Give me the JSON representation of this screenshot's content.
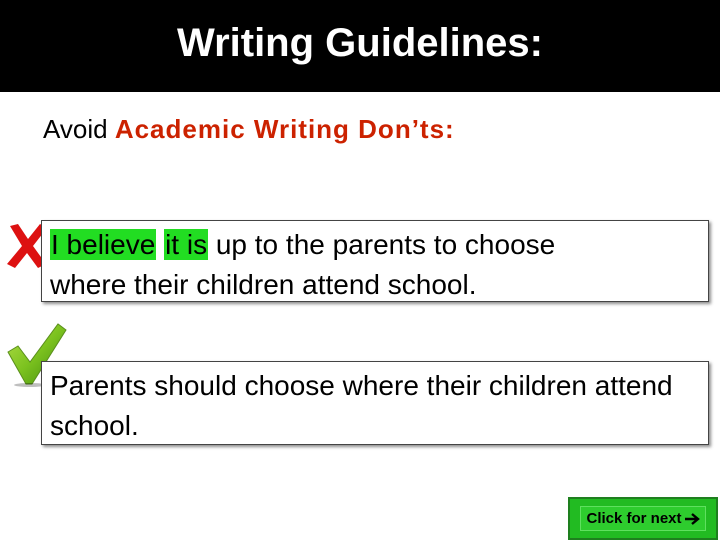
{
  "slide": {
    "title": "Writing Guidelines:",
    "intro_prefix": "Avoid",
    "intro_highlight": "Academic Writing Don’ts:"
  },
  "bad_example": {
    "highlight_1": "I believe",
    "highlight_2": "it is",
    "rest_line_1": " up to the parents to choose",
    "line_2": "where their children attend school.",
    "icon": "cross-icon"
  },
  "good_example": {
    "text": "Parents should choose where their children attend school.",
    "icon": "check-icon"
  },
  "navigation": {
    "next_label": "Click for next",
    "icon": "arrow-right-icon"
  },
  "colors": {
    "title_bg": "#000000",
    "title_text": "#ffffff",
    "accent_red": "#cc2200",
    "highlight_green": "#22dd22",
    "button_green": "#22bb22"
  }
}
